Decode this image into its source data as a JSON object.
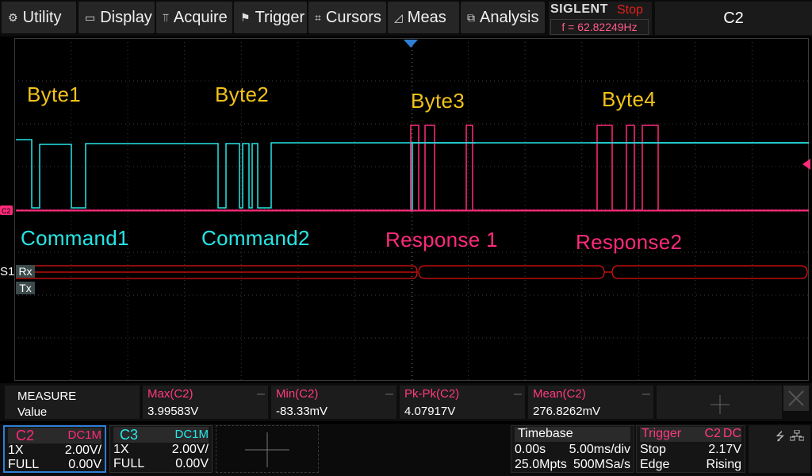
{
  "menu": [
    {
      "label": "Utility",
      "icon": "gear-icon",
      "glyph": "⚙"
    },
    {
      "label": "Display",
      "icon": "monitor-icon",
      "glyph": "▭"
    },
    {
      "label": "Acquire",
      "icon": "acquire-icon",
      "glyph": "⫪"
    },
    {
      "label": "Trigger",
      "icon": "flag-icon",
      "glyph": "⚑"
    },
    {
      "label": "Cursors",
      "icon": "cursor-icon",
      "glyph": "⌗"
    },
    {
      "label": "Meas",
      "icon": "ruler-icon",
      "glyph": "◿"
    },
    {
      "label": "Analysis",
      "icon": "analysis-icon",
      "glyph": "⧉"
    }
  ],
  "brand": {
    "logo": "SIGLENT",
    "state": "Stop",
    "frequency": "f = 62.82249Hz"
  },
  "selected_channel": "C2",
  "annotations": {
    "byte1": "Byte1",
    "byte2": "Byte2",
    "byte3": "Byte3",
    "byte4": "Byte4",
    "command1": "Command1",
    "command2": "Command2",
    "response1": "Response 1",
    "response2": "Response2"
  },
  "decode": {
    "bus": "S1",
    "rx": "Rx",
    "tx": "Tx"
  },
  "marker": {
    "channel": "C2"
  },
  "colors": {
    "c2": "#ff2a7a",
    "c3": "#27e6e6",
    "annotation": "#f2c318",
    "decode": "#e01010"
  },
  "measure": {
    "title": "MEASURE",
    "value_label": "Value",
    "items": [
      {
        "name": "Max(C2)",
        "value": "3.99583V"
      },
      {
        "name": "Min(C2)",
        "value": "-83.33mV"
      },
      {
        "name": "Pk-Pk(C2)",
        "value": "4.07917V"
      },
      {
        "name": "Mean(C2)",
        "value": "276.8262mV"
      }
    ]
  },
  "ch2": {
    "name": "C2",
    "coupling": "DC1M",
    "probe": "1X",
    "scale": "2.00V/",
    "bw": "FULL",
    "offset": "0.00V"
  },
  "ch3": {
    "name": "C3",
    "coupling": "DC1M",
    "probe": "1X",
    "scale": "2.00V/",
    "bw": "FULL",
    "offset": "0.00V"
  },
  "timebase": {
    "title": "Timebase",
    "delay": "0.00s",
    "scale": "5.00ms/div",
    "memory": "25.0Mpts",
    "rate": "500MSa/s"
  },
  "trigger": {
    "title": "Trigger",
    "source": "C2",
    "coupling": "DC",
    "mode": "Stop",
    "level": "2.17V",
    "type": "Edge",
    "slope": "Rising"
  }
}
